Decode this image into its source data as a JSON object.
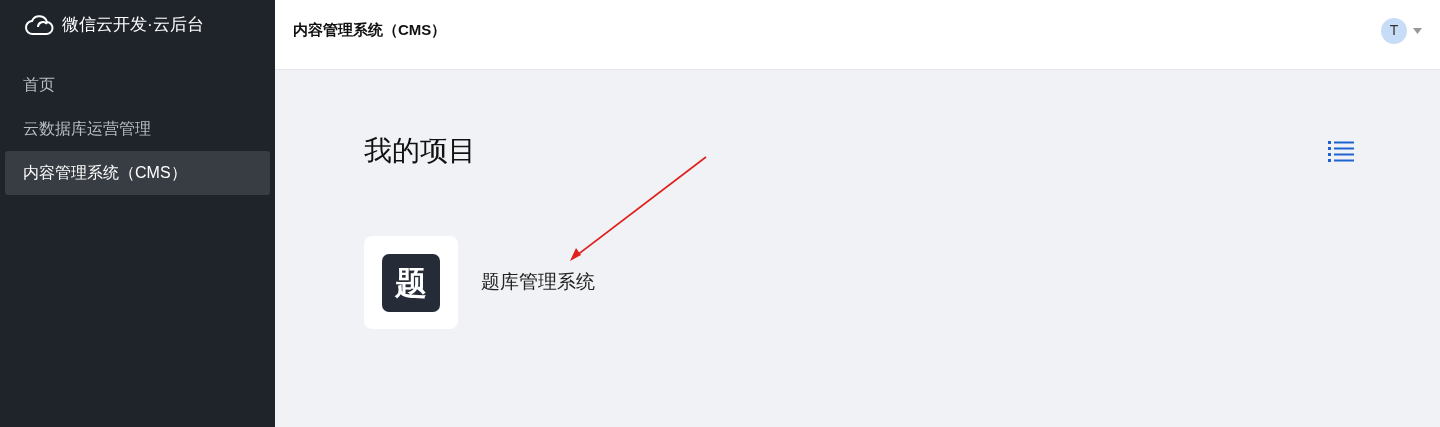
{
  "sidebar": {
    "brand": "微信云开发·云后台",
    "items": [
      {
        "label": "首页",
        "selected": false
      },
      {
        "label": "云数据库运营管理",
        "selected": false
      },
      {
        "label": "内容管理系统（CMS）",
        "selected": true
      }
    ]
  },
  "header": {
    "title": "内容管理系统（CMS）",
    "avatar": "T"
  },
  "main": {
    "heading": "我的项目",
    "projects": [
      {
        "icon_text": "题",
        "name": "题库管理系统"
      }
    ]
  }
}
